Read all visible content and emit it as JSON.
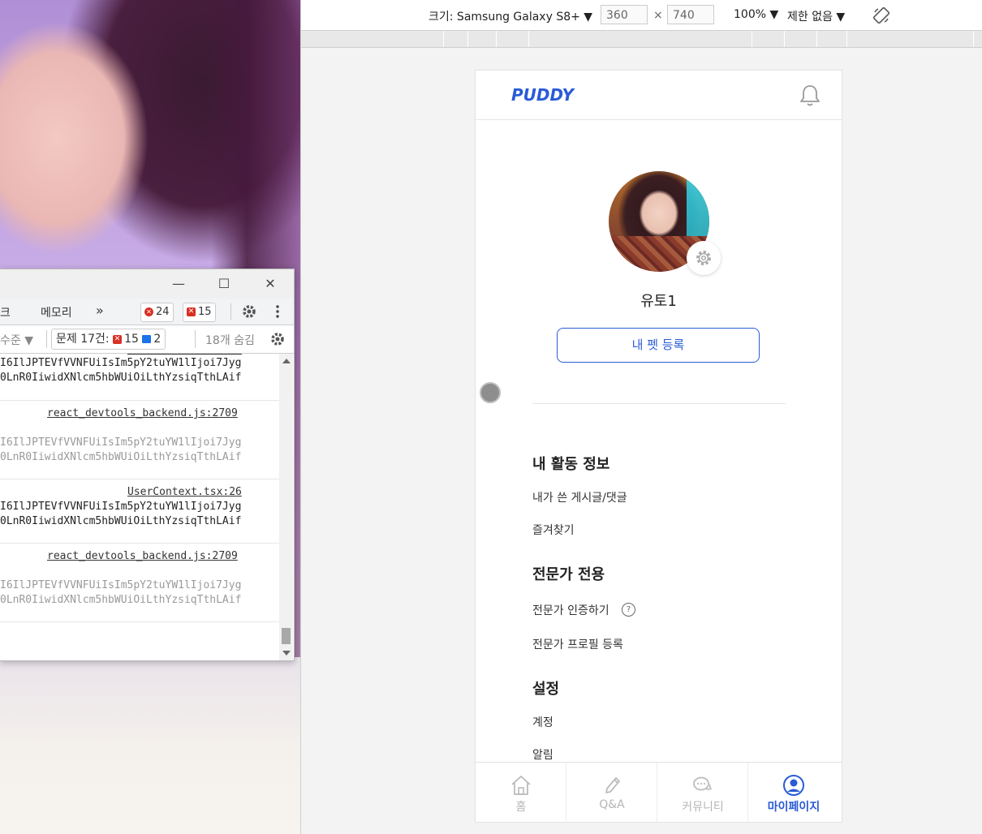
{
  "devtools": {
    "tabs": {
      "network_partial": "크",
      "memory": "메모리",
      "more": "»",
      "error_count": "24",
      "warning_count": "15"
    },
    "filter": {
      "level_partial": "수준 ▼",
      "issues_label": "문제 17건:",
      "issues_errors": "15",
      "issues_messages": "2",
      "hidden_count": "18개 숨김"
    },
    "log": [
      {
        "type": "data",
        "line1": "I6IlJPTEVfVVNFUiIsIm5pY2tuYW1lIjoi7Jyg",
        "line2": "0LnR0IiwidXNlcm5hbWUiOiLthYzsiqTthLAif"
      },
      {
        "type": "source",
        "text": "react_devtools_backend.js:2709"
      },
      {
        "type": "dim",
        "line1": "I6IlJPTEVfVVNFUiIsIm5pY2tuYW1lIjoi7Jyg",
        "line2": "0LnR0IiwidXNlcm5hbWUiOiLthYzsiqTthLAif"
      },
      {
        "type": "source",
        "text": "UserContext.tsx:26"
      },
      {
        "type": "data",
        "line1": "I6IlJPTEVfVVNFUiIsIm5pY2tuYW1lIjoi7Jyg",
        "line2": "0LnR0IiwidXNlcm5hbWUiOiLthYzsiqTthLAif"
      },
      {
        "type": "source",
        "text": "react_devtools_backend.js:2709"
      },
      {
        "type": "dim",
        "line1": "I6IlJPTEVfVVNFUiIsIm5pY2tuYW1lIjoi7Jyg",
        "line2": "0LnR0IiwidXNlcm5hbWUiOiLthYzsiqTthLAif"
      }
    ]
  },
  "device_toolbar": {
    "device_label": "크기: Samsung Galaxy S8+ ▼",
    "width_value": "360",
    "times": "×",
    "height_value": "740",
    "zoom": "100% ▼",
    "throttle": "제한 없음 ▼"
  },
  "app": {
    "logo": "PUDDY",
    "username": "유토1",
    "register_pet_button": "내 펫 등록",
    "sections": [
      {
        "title": "내 활동 정보",
        "items": [
          "내가 쓴 게시글/댓글",
          "즐겨찾기"
        ]
      },
      {
        "title": "전문가 전용",
        "items": [
          "전문가 인증하기",
          "전문가 프로필 등록"
        ]
      },
      {
        "title": "설정",
        "items": [
          "계정",
          "알림"
        ]
      }
    ],
    "help_icon_glyph": "?",
    "bottom_nav": [
      {
        "label": "홈",
        "icon": "home-icon",
        "active": false
      },
      {
        "label": "Q&A",
        "icon": "pencil-icon",
        "active": false
      },
      {
        "label": "커뮤니티",
        "icon": "chat-bubbles-icon",
        "active": false
      },
      {
        "label": "마이페이지",
        "icon": "user-circle-icon",
        "active": true
      }
    ],
    "accent_color": "#2a5bd7",
    "inactive_color": "#b6b6b6"
  }
}
